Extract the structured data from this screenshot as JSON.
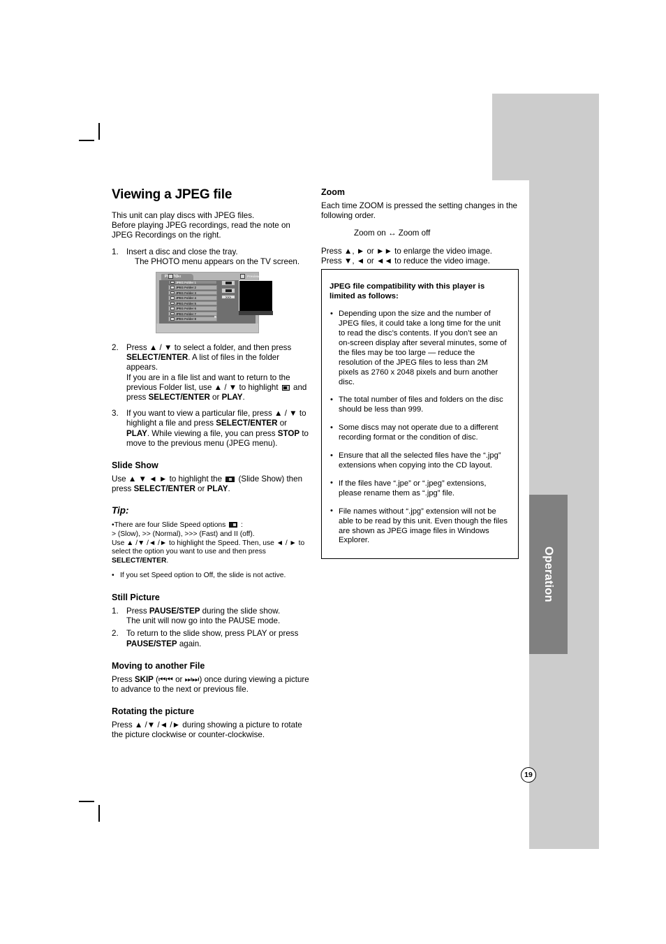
{
  "page": {
    "number": "19",
    "chapter_tab": "Operation"
  },
  "left_column": {
    "title": "Viewing a JPEG file",
    "intro_lines": [
      "This unit can play discs with JPEG files.",
      "Before playing JPEG recordings, read the note on",
      "JPEG Recordings on the right."
    ],
    "step1": {
      "num": "1.",
      "line1": "Insert a disc and close the tray.",
      "line2": "The PHOTO menu appears on the TV screen."
    },
    "step2": {
      "num": "2.",
      "t1": "Press ",
      "arrows1": "▲ / ▼",
      "t2": " to select a folder, and then press ",
      "b1": "SELECT/ENTER",
      "t3": ". A list of files in the folder appears.",
      "t4": "If you are in a file list and want to return to the previous Folder list, use ",
      "arrows2": "▲ / ▼",
      "t5": " to highlight ",
      "t6": " and press ",
      "b2": "SELECT/ENTER",
      "t7": " or ",
      "b3": "PLAY",
      "t8": "."
    },
    "step3": {
      "num": "3.",
      "t1": "If you want to view a particular file, press ",
      "arrows1": "▲ / ▼",
      "t2": " to highlight a file and press ",
      "b1": "SELECT/ENTER",
      "t3": " or ",
      "b2": "PLAY",
      "t4": ". While viewing a file, you can press ",
      "b3": "STOP",
      "t5": " to move to the previous menu (JPEG menu)."
    },
    "slide_show": {
      "heading": "Slide Show",
      "t1": "Use ",
      "arrows": "▲ ▼ ◄ ►",
      "t2": " to highlight the ",
      "t3": " (Slide Show) then press ",
      "b1": "SELECT/ENTER",
      "t4": " or ",
      "b2": "PLAY",
      "t5": "."
    },
    "tip": {
      "heading": "Tip:",
      "line1a": "•There are four Slide Speed options ",
      "line1b": " :",
      "line2": "> (Slow), >> (Normal), >>> (Fast) and II (off).",
      "line3": "Use ▲ /▼ /◄ /► to highlight the Speed. Then, use ◄ / ► to",
      "line4": "select the option you want to use and then press",
      "line5": "SELECT/ENTER",
      "line5_end": ".",
      "bullet_dot": "•",
      "bullet": "If you set Speed option to Off, the slide is not active."
    },
    "still_picture": {
      "heading": "Still Picture",
      "items": [
        {
          "num": "1.",
          "t1": "Press ",
          "b1": "PAUSE/STEP",
          "t2": " during the slide show.",
          "t3": "The unit will now go into the PAUSE mode."
        },
        {
          "num": "2.",
          "t1": "To return to the slide show, press PLAY or press ",
          "b1": "PAUSE/STEP",
          "t2": " again."
        }
      ]
    },
    "moving_file": {
      "heading": "Moving to another File",
      "t1": "Press ",
      "b1": "SKIP",
      "t2": " (⏮⏮ or ⏭⏭) once during viewing a picture to advance to the next or previous file."
    },
    "rotating": {
      "heading": "Rotating the picture",
      "t1": "Press ▲ /▼ /◄ /► during showing a picture to rotate the picture clockwise or counter-clockwise."
    }
  },
  "right_column": {
    "zoom": {
      "heading": "Zoom",
      "intro": "Each time ZOOM is pressed the setting changes in the following order.",
      "order": "Zoom on ↔ Zoom off",
      "line1": "Press ▲, ► or ►► to enlarge the video image.",
      "line2": "Press ▼, ◄ or ◄◄ to reduce the video image."
    },
    "note_box": {
      "heading": "JPEG file compatibility with this player is limited as follows:",
      "bullets": [
        "Depending upon the size and the number of JPEG files, it could take a long time for the unit to read the disc’s contents. If you don’t see an on-screen display after several minutes, some of the files may be too large — reduce the resolution of the JPEG files to less than 2M pixels as 2760 x 2048 pixels and burn another disc.",
        "The total number of files and folders on the disc should be less than 999.",
        "Some discs may not operate due to a different recording format or the condition of disc.",
        "Ensure that all the selected files have the “.jpg” extensions when copying into the CD layout.",
        "If the files have “.jpe” or “.jpeg” extensions, please rename them as “.jpg” file.",
        "File names without “.jpg” extension will not be able to be read by this unit. Even though the files are shown as JPEG image files in Windows Explorer."
      ],
      "bullet_dot": "•"
    }
  },
  "osd_screenshot": {
    "title": "PHOTO",
    "list_header": "List",
    "preview_header": "Preview",
    "folders": [
      "JPEG Folder 1",
      "JPEG Folder 2",
      "JPEG Folder 3",
      "JPEG Folder 4",
      "JPEG Folder 5",
      "JPEG Folder 6",
      "JPEG Folder 7",
      "JPEG Folder 8"
    ],
    "selected_index": 0,
    "speed_glyph": ">>>"
  },
  "colors": {
    "panel_gray": "#cccccc",
    "tab_gray": "#808080",
    "text": "#000000",
    "page_bg": "#ffffff"
  }
}
